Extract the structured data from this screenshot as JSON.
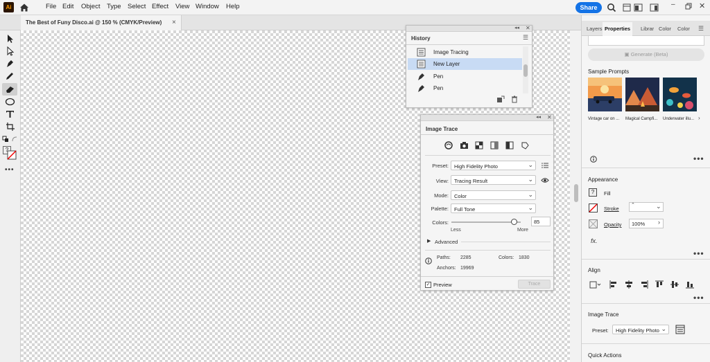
{
  "app": {
    "logo_text": "Ai",
    "menu": [
      "File",
      "Edit",
      "Object",
      "Type",
      "Select",
      "Effect",
      "View",
      "Window",
      "Help"
    ],
    "share_label": "Share",
    "brand_color": "#1473e6"
  },
  "document": {
    "tab_title": "The Best of Funy Disco.ai @ 150 % (CMYK/Preview)",
    "close_glyph": "×"
  },
  "history": {
    "title": "History",
    "items": [
      {
        "label": "Image Tracing",
        "icon": "doc-icon"
      },
      {
        "label": "New Layer",
        "icon": "doc-icon",
        "selected": true
      },
      {
        "label": "Pen",
        "icon": "pen-icon"
      },
      {
        "label": "Pen",
        "icon": "pen-icon"
      }
    ]
  },
  "image_trace": {
    "title": "Image Trace",
    "preset_label": "Preset:",
    "preset_value": "High Fidelity Photo",
    "view_label": "View:",
    "view_value": "Tracing Result",
    "mode_label": "Mode:",
    "mode_value": "Color",
    "palette_label": "Palette:",
    "palette_value": "Full Tone",
    "colors_label": "Colors:",
    "colors_value": "85",
    "colors_slider_fraction": 0.9,
    "less_label": "Less",
    "more_label": "More",
    "advanced_label": "Advanced",
    "paths_label": "Paths:",
    "paths_value": "2285",
    "colors_stat_label": "Colors:",
    "colors_stat_value": "1830",
    "anchors_label": "Anchors:",
    "anchors_value": "19969",
    "preview_label": "Preview",
    "trace_button": "Trace"
  },
  "right_panel": {
    "tabs": [
      "Layers",
      "Properties",
      "Librar",
      "Color",
      "Color"
    ],
    "active_tab": "Properties",
    "generate_label": "Generate (Beta)",
    "sample_prompts_title": "Sample Prompts",
    "sample_prompts": [
      "Vintage car on ...",
      "Magical Campfi...",
      "Underwater illu..."
    ],
    "appearance_title": "Appearance",
    "fill_label": "Fill",
    "stroke_label": "Stroke",
    "opacity_label": "Opacity",
    "opacity_value": "100%",
    "align_title": "Align",
    "image_trace_title": "Image Trace",
    "preset_label": "Preset:",
    "preset_value": "High Fidelity Photo",
    "quick_actions_title": "Quick Actions"
  }
}
